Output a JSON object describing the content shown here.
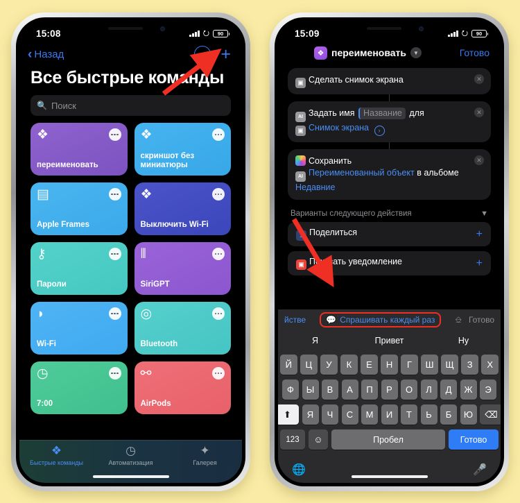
{
  "colors": {
    "page_background": "#faeca6",
    "accent_blue": "#3a79f2",
    "annotation_red": "#ef2f24",
    "screen_black": "#000000",
    "card_grey": "#1c1c1e"
  },
  "left_phone": {
    "status": {
      "time": "15:08",
      "battery": "90"
    },
    "nav": {
      "back_label": "Назад",
      "more_icon": "ellipsis-circle-icon",
      "add_icon": "plus-icon"
    },
    "title": "Все быстрые команды",
    "search": {
      "placeholder": "Поиск",
      "icon": "search-icon"
    },
    "tiles": [
      {
        "label": "переименовать",
        "icon": "shortcuts-icon",
        "icon_glyph": "❖",
        "color": "#7b53c0",
        "color2": "#8f62cf"
      },
      {
        "label": "скриншот без миниатюры",
        "icon": "shortcuts-icon",
        "icon_glyph": "❖",
        "color": "#38a7e8",
        "color2": "#45b4ef"
      },
      {
        "label": "Apple Frames",
        "icon": "iphone-icon",
        "icon_glyph": "▤",
        "color": "#3ba9ea",
        "color2": "#4ab6f0"
      },
      {
        "label": "Выключить Wi-Fi",
        "icon": "shortcuts-icon",
        "icon_glyph": "❖",
        "color": "#3c46bb",
        "color2": "#4b55c9"
      },
      {
        "label": "Пароли",
        "icon": "key-icon",
        "icon_glyph": "⚷",
        "color": "#45c7c1",
        "color2": "#53d2c9"
      },
      {
        "label": "SiriGPT",
        "icon": "waveform-icon",
        "icon_glyph": "⦀",
        "color": "#8b56cf",
        "color2": "#9a63d8"
      },
      {
        "label": "Wi-Fi",
        "icon": "wifi-icon",
        "icon_glyph": "◗",
        "color": "#3fa9f0",
        "color2": "#4fb4f4"
      },
      {
        "label": "Bluetooth",
        "icon": "airplay-icon",
        "icon_glyph": "◎",
        "color": "#46c5c4",
        "color2": "#55d0cd"
      },
      {
        "label": "7:00",
        "icon": "clock-icon",
        "icon_glyph": "◷",
        "color": "#3fc08e",
        "color2": "#4fcb99"
      },
      {
        "label": "AirPods",
        "icon": "airpods-icon",
        "icon_glyph": "⚯",
        "color": "#e8616a",
        "color2": "#ef6f77"
      }
    ],
    "tabs": [
      {
        "label": "Быстрые команды",
        "icon": "shortcuts-icon",
        "glyph": "❖",
        "active": true
      },
      {
        "label": "Автоматизация",
        "icon": "automation-icon",
        "glyph": "◷",
        "active": false
      },
      {
        "label": "Галерея",
        "icon": "gallery-icon",
        "glyph": "✦",
        "active": false
      }
    ]
  },
  "right_phone": {
    "status": {
      "time": "15:09",
      "battery": "90"
    },
    "header": {
      "shortcut_name": "переименовать",
      "badge_icon": "shortcuts-icon",
      "chevron_icon": "chevron-down-icon",
      "done_label": "Готово"
    },
    "actions": [
      {
        "id": "screenshot",
        "icon": "screenshot-icon",
        "text": "Сделать снимок экрана",
        "close_icon": "close-icon"
      },
      {
        "id": "set-name",
        "icon": "ai-icon",
        "text_before": "Задать имя",
        "field_value": "Название",
        "text_after": "для",
        "sub_icon": "screenshot-icon",
        "sub_link": "Снимок экрана",
        "arrow_icon": "chevron-right-circle-icon",
        "close_icon": "close-icon"
      },
      {
        "id": "save",
        "icon": "photos-icon",
        "title": "Сохранить",
        "token": "Переименованный объект",
        "text_mid": "в альбоме",
        "token2": "Недавние",
        "token2_icon": "ai-icon",
        "close_icon": "close-icon"
      }
    ],
    "next_section": {
      "title": "Варианты следующего действия",
      "collapse_icon": "chevron-down-icon",
      "items": [
        {
          "label": "Поделиться",
          "icon": "share-icon",
          "glyph": "↥",
          "add_icon": "plus-icon"
        },
        {
          "label": "Показать уведомление",
          "icon": "notify-icon",
          "glyph": "▣",
          "add_icon": "plus-icon"
        }
      ]
    },
    "accessory_bar": {
      "left_text": "йстве",
      "chip_label": "Спрашивать каждый раз",
      "chip_icon": "ask-each-time-icon",
      "keyboard_icon": "keyboard-icon",
      "done_label": "Готово",
      "highlighted": true
    },
    "predictions": [
      "Я",
      "Привет",
      "Ну"
    ],
    "keyboard": {
      "row1": [
        "Й",
        "Ц",
        "У",
        "К",
        "Е",
        "Н",
        "Г",
        "Ш",
        "Щ",
        "З",
        "Х"
      ],
      "row2": [
        "Ф",
        "Ы",
        "В",
        "А",
        "П",
        "Р",
        "О",
        "Л",
        "Д",
        "Ж",
        "Э"
      ],
      "row3": [
        "Я",
        "Ч",
        "С",
        "М",
        "И",
        "Т",
        "Ь",
        "Б",
        "Ю"
      ],
      "shift_icon": "shift-icon",
      "delete_icon": "backspace-icon",
      "numbers_key": "123",
      "emoji_icon": "emoji-icon",
      "space_label": "Пробел",
      "go_label": "Готово",
      "globe_icon": "globe-icon",
      "mic_icon": "microphone-icon"
    }
  }
}
